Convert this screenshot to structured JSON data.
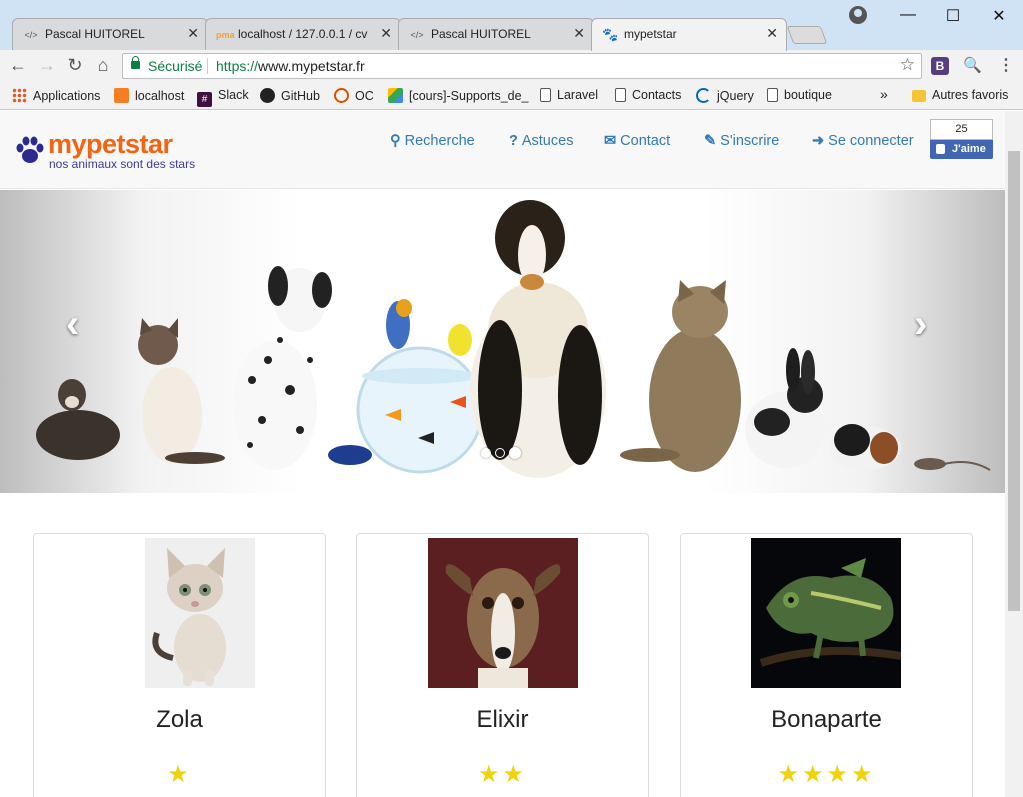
{
  "browser": {
    "tabs": [
      {
        "title": "Pascal HUITOREL",
        "icon": "code-icon"
      },
      {
        "title": "localhost / 127.0.0.1 / cv",
        "icon": "pma-icon"
      },
      {
        "title": "Pascal HUITOREL",
        "icon": "code-icon"
      },
      {
        "title": "mypetstar",
        "icon": "paw-icon"
      }
    ],
    "secure_label": "Sécurisé",
    "url_scheme": "https://",
    "url_rest": "www.mypetstar.fr",
    "extension_label": "B",
    "bookmarks": [
      "Applications",
      "localhost",
      "Slack",
      "GitHub",
      "OC",
      "[cours]-Supports_de_",
      "Laravel",
      "Contacts",
      "jQuery",
      "boutique"
    ],
    "bookmarks_overflow": "»",
    "other_bookmarks": "Autres favoris"
  },
  "site": {
    "brand": "mypetstar",
    "tagline": "nos animaux sont des stars",
    "nav": {
      "search": "Recherche",
      "tips": "Astuces",
      "contact": "Contact",
      "register": "S'inscrire",
      "login": "Se connecter"
    },
    "facebook": {
      "count": "25",
      "like": "J'aime"
    },
    "carousel": {
      "slides": 3,
      "active": 3
    }
  },
  "pets": [
    {
      "name": "Zola",
      "stars": 1
    },
    {
      "name": "Elixir",
      "stars": 2
    },
    {
      "name": "Bonaparte",
      "stars": 4
    }
  ],
  "colors": {
    "brand_orange": "#f06414",
    "link_blue": "#337ab7",
    "star_yellow": "#f0d20d",
    "fb_blue": "#4267b2"
  }
}
